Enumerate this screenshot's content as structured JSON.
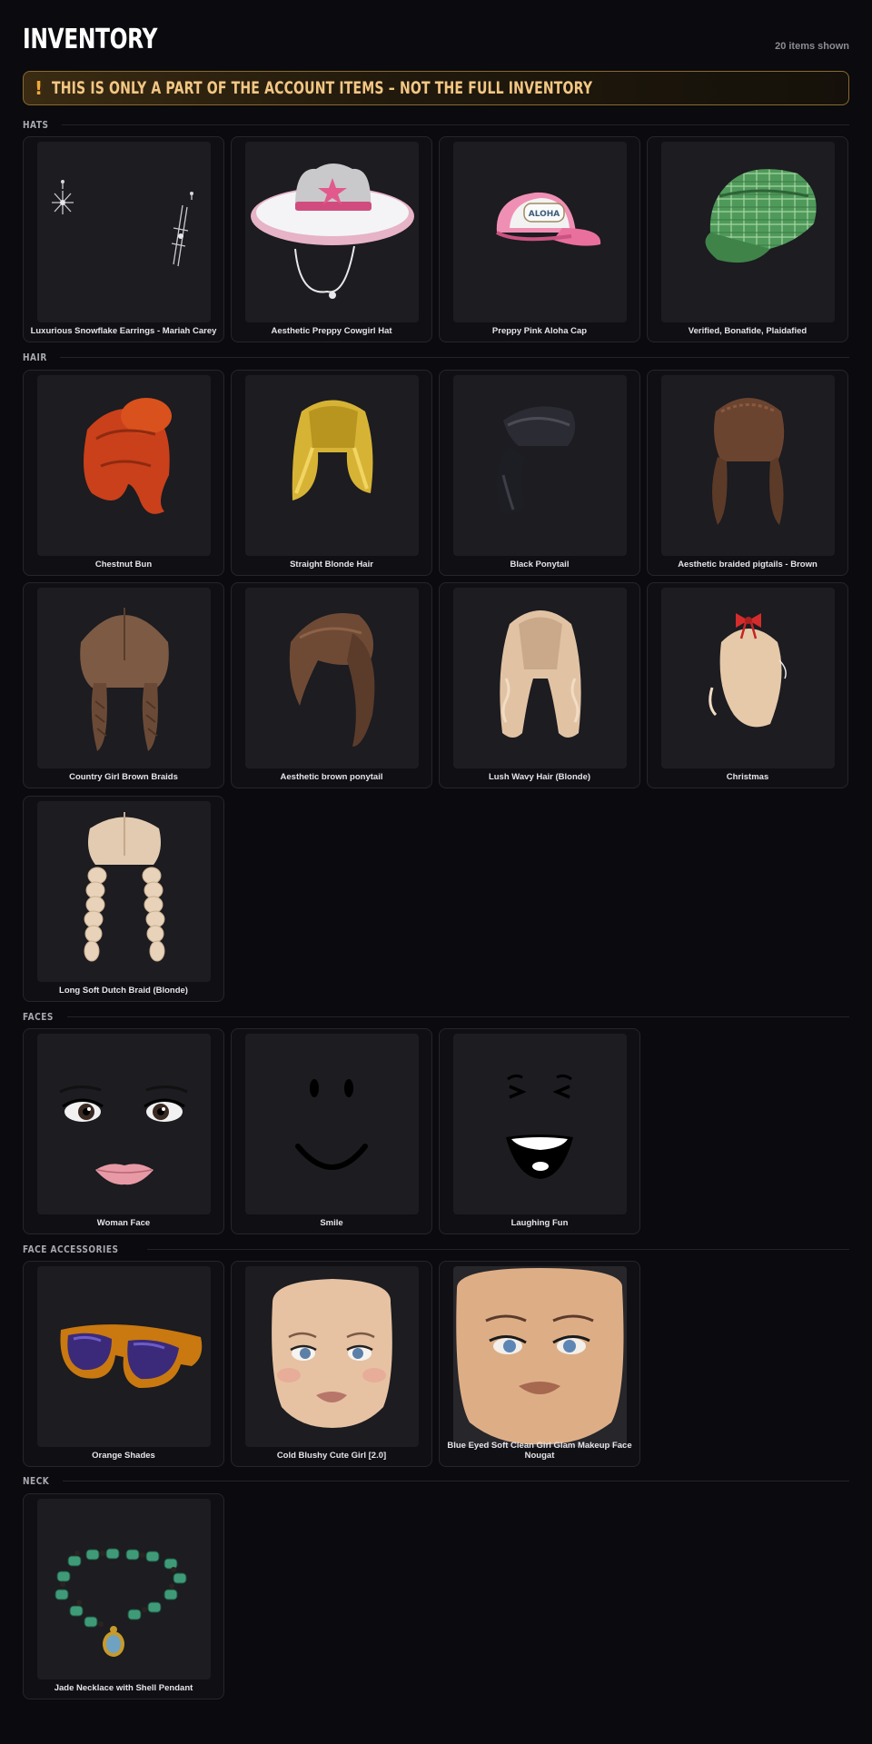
{
  "header": {
    "title": "INVENTORY",
    "count_label": "20 items shown"
  },
  "warning": {
    "icon": "!",
    "text": "THIS IS ONLY A PART OF THE ACCOUNT ITEMS – NOT THE FULL INVENTORY",
    "accent_color": "#f2a83a"
  },
  "sections": {
    "hats": {
      "label": "HATS",
      "items": [
        {
          "name": "Luxurious Snowflake Earrings - Mariah Carey",
          "icon": "snowflake-earrings"
        },
        {
          "name": "Aesthetic Preppy Cowgirl Hat",
          "icon": "cowgirl-hat"
        },
        {
          "name": "Preppy Pink Aloha Cap",
          "icon": "aloha-cap",
          "cap_text": "ALOHA"
        },
        {
          "name": "Verified, Bonafide, Plaidafied",
          "icon": "plaid-cap"
        }
      ]
    },
    "hair": {
      "label": "HAIR",
      "items": [
        {
          "name": "Chestnut Bun",
          "icon": "hair-bun"
        },
        {
          "name": "Straight Blonde Hair",
          "icon": "hair-straight"
        },
        {
          "name": "Black Ponytail",
          "icon": "hair-ponytail"
        },
        {
          "name": "Aesthetic braided pigtails - Brown",
          "icon": "hair-pigtails"
        },
        {
          "name": "Country Girl Brown Braids",
          "icon": "hair-braids"
        },
        {
          "name": "Aesthetic brown ponytail",
          "icon": "hair-side-ponytail"
        },
        {
          "name": "Lush Wavy Hair (Blonde)",
          "icon": "hair-wavy"
        },
        {
          "name": "Christmas",
          "icon": "hair-bow"
        },
        {
          "name": "Long Soft Dutch Braid (Blonde)",
          "icon": "hair-dutch-braids"
        }
      ]
    },
    "faces": {
      "label": "FACES",
      "items": [
        {
          "name": "Woman Face",
          "icon": "face-woman"
        },
        {
          "name": "Smile",
          "icon": "face-smile"
        },
        {
          "name": "Laughing Fun",
          "icon": "face-laughing"
        }
      ]
    },
    "face_accessories": {
      "label": "FACE ACCESSORIES",
      "items": [
        {
          "name": "Orange Shades",
          "icon": "sunglasses"
        },
        {
          "name": "Cold Blushy Cute Girl [2.0]",
          "icon": "face-head-light"
        },
        {
          "name": "Blue Eyed Soft Clean Girl Glam Makeup Face Nougat",
          "icon": "face-head-tan"
        }
      ]
    },
    "neck": {
      "label": "NECK",
      "items": [
        {
          "name": "Jade Necklace with Shell Pendant",
          "icon": "necklace"
        }
      ]
    }
  },
  "colors": {
    "background": "#0a0a0f",
    "card": "#101014",
    "thumb": "#1c1c21"
  }
}
